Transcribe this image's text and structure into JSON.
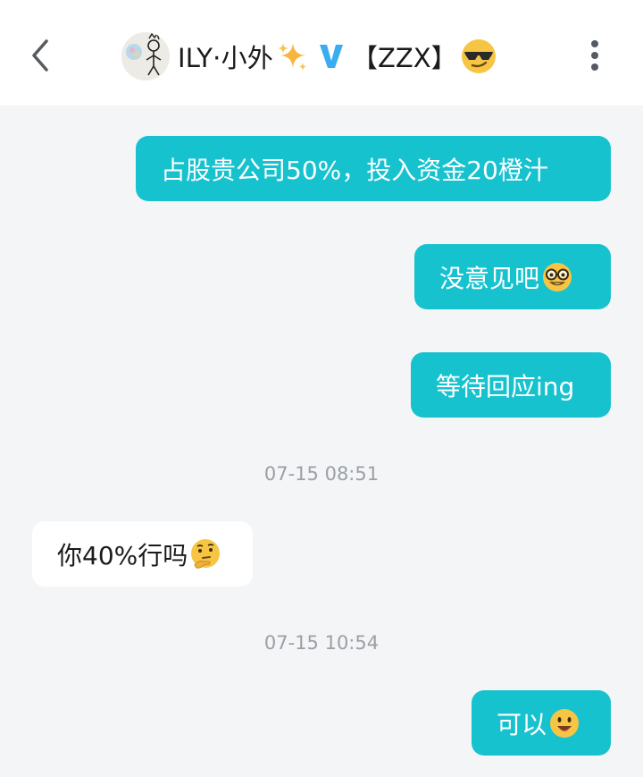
{
  "header": {
    "contact_name": "ILY·小外",
    "title_suffix": "【ZZX】",
    "verified_badge": "V",
    "icons": {
      "back": "chevron-left-icon",
      "more": "vertical-dots-icon",
      "sparkle": "sparkles-icon",
      "emoji": "sunglasses-face-icon"
    }
  },
  "messages": [
    {
      "direction": "outgoing",
      "text": "占股贵公司50%，投入资金20橙汁",
      "emoji": ""
    },
    {
      "direction": "outgoing",
      "text": "没意见吧",
      "emoji": "nerd-face-icon"
    },
    {
      "direction": "outgoing",
      "text": "等待回应ing",
      "emoji": ""
    },
    {
      "type": "timestamp",
      "text": "07-15 08:51"
    },
    {
      "direction": "incoming",
      "text": "你40%行吗",
      "emoji": "thinking-face-icon"
    },
    {
      "type": "timestamp",
      "text": "07-15 10:54"
    },
    {
      "direction": "outgoing",
      "text": "可以",
      "emoji": "smiling-face-icon"
    }
  ],
  "colors": {
    "outgoing_bubble": "#17c2cf",
    "incoming_bubble": "#ffffff",
    "background": "#f4f5f7",
    "verified_badge": "#38aef0",
    "timestamp_text": "#9aa0a6"
  }
}
